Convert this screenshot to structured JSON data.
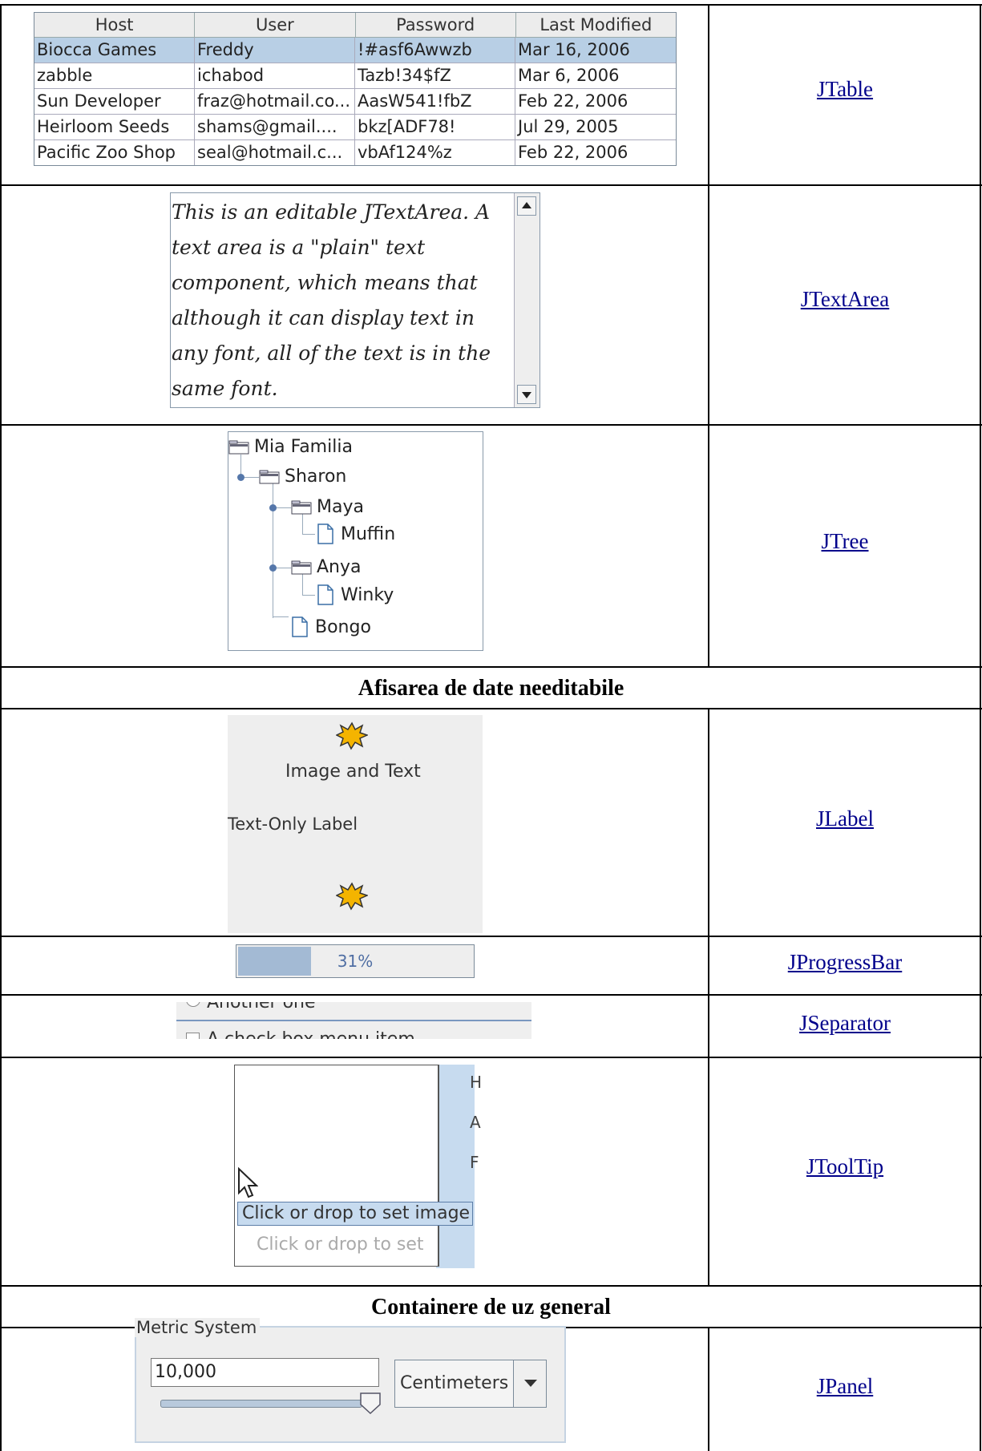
{
  "jtable": {
    "columns": [
      "Host",
      "User",
      "Password",
      "Last Modified"
    ],
    "rows": [
      [
        "Biocca Games",
        "Freddy",
        "!#asf6Awwzb",
        "Mar 16, 2006"
      ],
      [
        "zabble",
        "ichabod",
        "Tazb!34$fZ",
        "Mar 6, 2006"
      ],
      [
        "Sun Developer",
        "fraz@hotmail.co...",
        "AasW541!fbZ",
        "Feb 22, 2006"
      ],
      [
        "Heirloom Seeds",
        "shams@gmail....",
        "bkz[ADF78!",
        "Jul 29, 2005"
      ],
      [
        "Pacific Zoo Shop",
        "seal@hotmail.c...",
        "vbAf124%z",
        "Feb 22, 2006"
      ]
    ],
    "selected_row": 0
  },
  "jtextarea": {
    "lines": [
      "This is an editable JTextArea. A",
      "text area is a \"plain\" text",
      "component, which means that",
      "although it can display text in",
      "any font, all of the text is in the",
      "same font."
    ]
  },
  "jtree": {
    "root": "Mia Familia",
    "n1": "Sharon",
    "n2": "Maya",
    "n3": "Muffin",
    "n4": "Anya",
    "n5": "Winky",
    "n6": "Bongo"
  },
  "jlabel": {
    "image_text": "Image and Text",
    "text_only": "Text-Only Label"
  },
  "jprogress": {
    "value_label": "31%",
    "value": 31
  },
  "jseparator": {
    "above": "Another one",
    "below": "A check box menu item"
  },
  "jtooltip": {
    "tip": "Click or drop to set image",
    "ghost": "Click or drop to set",
    "side_chars": [
      "H",
      "A",
      "F"
    ]
  },
  "headings": {
    "noneditable": "Afisarea de date needitabile",
    "containers": "Containere de uz general"
  },
  "jpanel": {
    "legend": "Metric System",
    "field_value": "10,000",
    "combo_value": "Centimeters"
  },
  "links": {
    "jtable": "JTable",
    "jtextarea": "JTextArea",
    "jtree": "JTree",
    "jlabel": "JLabel",
    "jprogressbar": "JProgressBar",
    "jseparator": "JSeparator",
    "jtooltip": "JToolTip",
    "jpanel": "JPanel"
  },
  "colors": {
    "link": "#00008b",
    "selection": "#b8cfe5",
    "progress_fill": "#a3bad4",
    "tooltip_bg": "#c7dbef"
  }
}
